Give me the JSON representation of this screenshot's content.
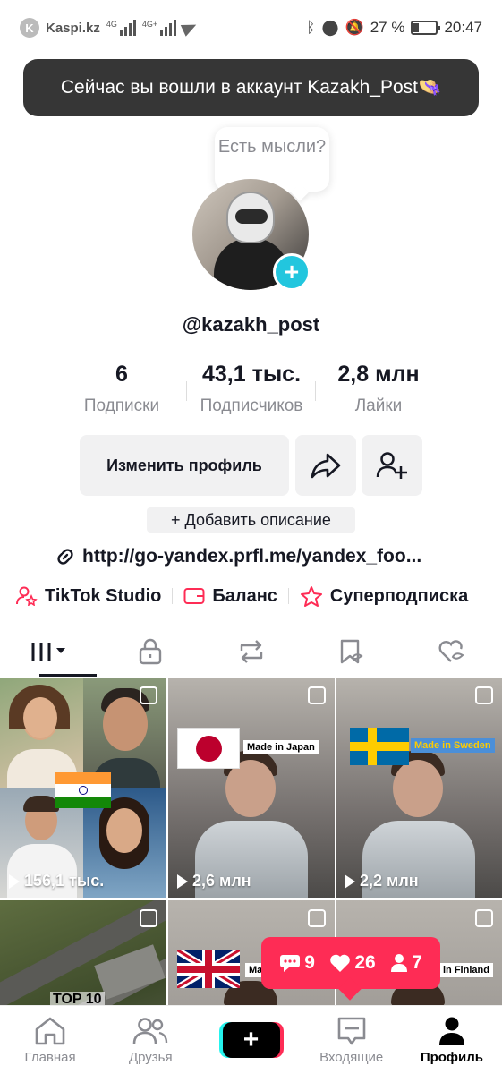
{
  "status_bar": {
    "carrier": "Kaspi.kz",
    "signal1": "4G",
    "signal2": "4G+",
    "battery_percent": "27 %",
    "battery_level": 0.27,
    "time": "20:47"
  },
  "toast": {
    "text": "Сейчас вы вошли в аккаунт Kazakh_Post👒"
  },
  "bubble": {
    "text": "Есть мысли?"
  },
  "profile": {
    "username": "@kazakh_post"
  },
  "stats": [
    {
      "value": "6",
      "label": "Подписки"
    },
    {
      "value": "43,1 тыс.",
      "label": "Подписчиков"
    },
    {
      "value": "2,8 млн",
      "label": "Лайки"
    }
  ],
  "buttons": {
    "edit_profile": "Изменить профиль"
  },
  "add_description": "+ Добавить описание",
  "link": "http://go-yandex.prfl.me/yandex_foo...",
  "quick_links": [
    {
      "label": "TikTok Studio",
      "icon": "person-star-icon"
    },
    {
      "label": "Баланс",
      "icon": "wallet-icon"
    },
    {
      "label": "Суперподписка",
      "icon": "star-badge-icon"
    }
  ],
  "tabs": [
    {
      "icon": "grid-icon",
      "active": true
    },
    {
      "icon": "lock-icon"
    },
    {
      "icon": "repost-icon"
    },
    {
      "icon": "bookmark-icon"
    },
    {
      "icon": "heart-hidden-icon"
    }
  ],
  "videos": [
    {
      "views": "156,1 тыс."
    },
    {
      "views": "2,6 млн",
      "flag_text": "Made in Japan"
    },
    {
      "views": "2,2 млн",
      "flag_text": "Made in Sweden"
    },
    {
      "overlay_text": "TOP 10"
    },
    {
      "flag_text": "Ma"
    },
    {
      "flag_text": "in Finland"
    }
  ],
  "notifications": {
    "comments": "9",
    "likes": "26",
    "followers": "7"
  },
  "bottom_nav": [
    {
      "label": "Главная"
    },
    {
      "label": "Друзья"
    },
    {
      "label": ""
    },
    {
      "label": "Входящие"
    },
    {
      "label": "Профиль"
    }
  ]
}
